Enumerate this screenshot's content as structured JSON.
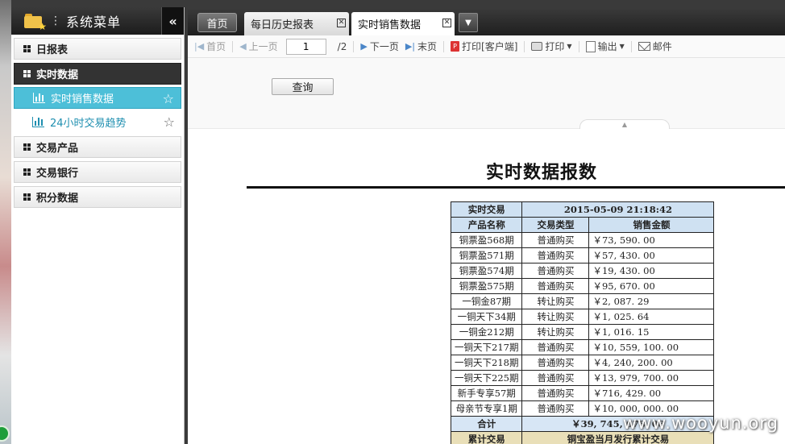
{
  "sidebar": {
    "title": "系统菜单",
    "collapse_icon": "«",
    "groups": [
      {
        "label": "日报表"
      },
      {
        "label": "实时数据",
        "active": true
      },
      {
        "label": "交易产品"
      },
      {
        "label": "交易银行"
      },
      {
        "label": "积分数据"
      }
    ],
    "sub_items": [
      {
        "label": "实时销售数据",
        "active": true
      },
      {
        "label": "24小时交易趋势"
      }
    ]
  },
  "tabs": {
    "home": "首页",
    "items": [
      {
        "label": "每日历史报表"
      },
      {
        "label": "实时销售数据",
        "active": true
      }
    ]
  },
  "toolbar": {
    "first": "首页",
    "prev": "上一页",
    "page_value": "1",
    "page_total": "/2",
    "next": "下一页",
    "last": "末页",
    "print_client": "打印[客户端]",
    "print": "打印",
    "export": "输出",
    "mail": "邮件"
  },
  "query": {
    "button": "查询"
  },
  "report": {
    "title": "实时数据报数",
    "realtime_label": "实时交易",
    "timestamp": "2015-05-09 21:18:42",
    "columns": [
      "产品名称",
      "交易类型",
      "销售金额"
    ],
    "rows": [
      [
        "铜票盈568期",
        "普通购买",
        "￥73, 590. 00"
      ],
      [
        "铜票盈571期",
        "普通购买",
        "￥57, 430. 00"
      ],
      [
        "铜票盈574期",
        "普通购买",
        "￥19, 430. 00"
      ],
      [
        "铜票盈575期",
        "普通购买",
        "￥95, 670. 00"
      ],
      [
        "一铜金87期",
        "转让购买",
        "￥2, 087. 29"
      ],
      [
        "一铜天下34期",
        "转让购买",
        "￥1, 025. 64"
      ],
      [
        "一铜金212期",
        "转让购买",
        "￥1, 016. 15"
      ],
      [
        "一铜天下217期",
        "普通购买",
        "￥10, 559, 100. 00"
      ],
      [
        "一铜天下218期",
        "普通购买",
        "￥4, 240, 200. 00"
      ],
      [
        "一铜天下225期",
        "普通购买",
        "￥13, 979, 700. 00"
      ],
      [
        "新手专享57期",
        "普通购买",
        "￥716, 429. 00"
      ],
      [
        "母亲节专享1期",
        "普通购买",
        "￥10, 000, 000. 00"
      ]
    ],
    "total_label": "合计",
    "total_value": "￥39, 745, 678. 08",
    "cumulative_label": "累计交易",
    "cumulative_value": "铜宝盈当月发行累计交易"
  },
  "watermark": "www.wooyun.org",
  "colors": {
    "active_sub": "#4dbfd8",
    "header_dark": "#1c1c1c",
    "table_header": "#cfe1f2"
  }
}
